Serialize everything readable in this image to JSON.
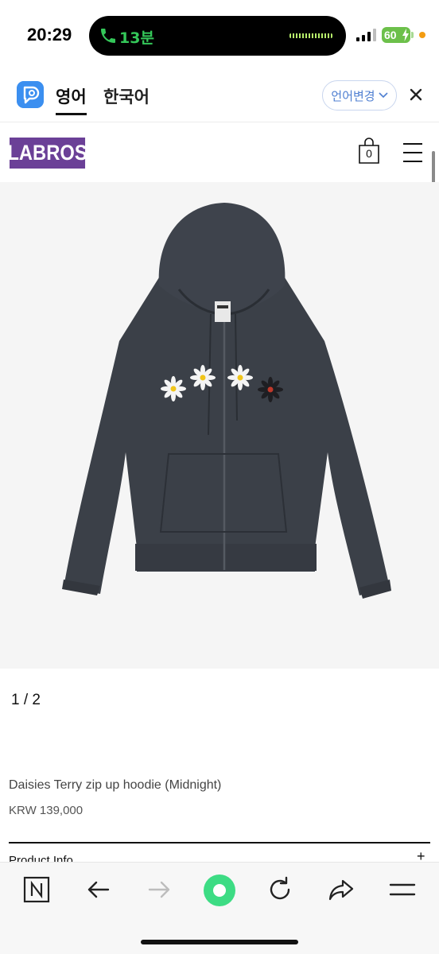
{
  "status_bar": {
    "time": "20:29",
    "call_duration": "13분",
    "battery": "60"
  },
  "translator": {
    "lang_source": "영어",
    "lang_target": "한국어",
    "change_language": "언어변경"
  },
  "site": {
    "logo": "LABROS",
    "cart_count": "0"
  },
  "product": {
    "image_counter": "1 / 2",
    "name": "Daisies Terry zip up hoodie (Midnight)",
    "price": "KRW 139,000",
    "info_label": "Product Info",
    "expand_symbol": "+"
  },
  "colors": {
    "accent_purple": "#6b4097",
    "call_green": "#34c759",
    "battery_green": "#6cc04a",
    "browser_green": "#3ddc84",
    "link_blue": "#4f7fd1",
    "hoodie": "#3b4048"
  },
  "icons": {
    "browser_toolbar": [
      "naver-n-icon",
      "back-arrow-icon",
      "forward-arrow-icon",
      "home-green-icon",
      "refresh-icon",
      "share-icon",
      "menu-lines-icon"
    ]
  }
}
